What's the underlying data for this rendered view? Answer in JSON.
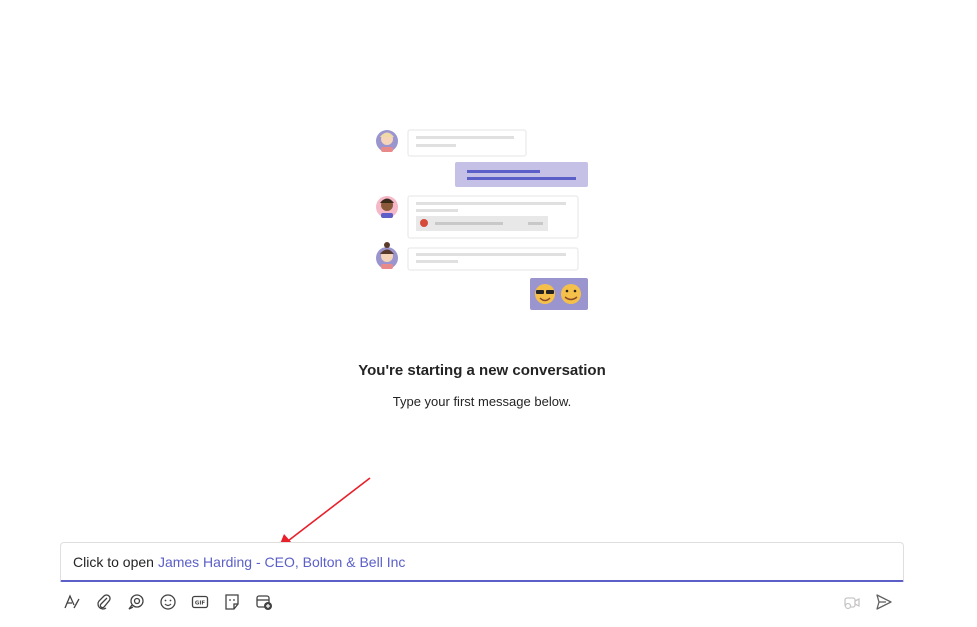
{
  "empty_state": {
    "title": "You're starting a new conversation",
    "subtitle": "Type your first message below.",
    "illustration": "chat-conversation-illustration"
  },
  "compose": {
    "prefix": "Click to open",
    "link_text": "James Harding - CEO, Bolton & Bell Inc"
  },
  "toolbar": {
    "left_icons": [
      "format-icon",
      "attach-icon",
      "loop-icon",
      "emoji-icon",
      "gif-icon",
      "sticker-icon",
      "schedule-meeting-icon"
    ],
    "right_icons": [
      "video-clip-icon",
      "send-icon"
    ]
  },
  "colors": {
    "accent": "#5b5fc7",
    "annotation": "#e8202a",
    "text": "#242424"
  }
}
